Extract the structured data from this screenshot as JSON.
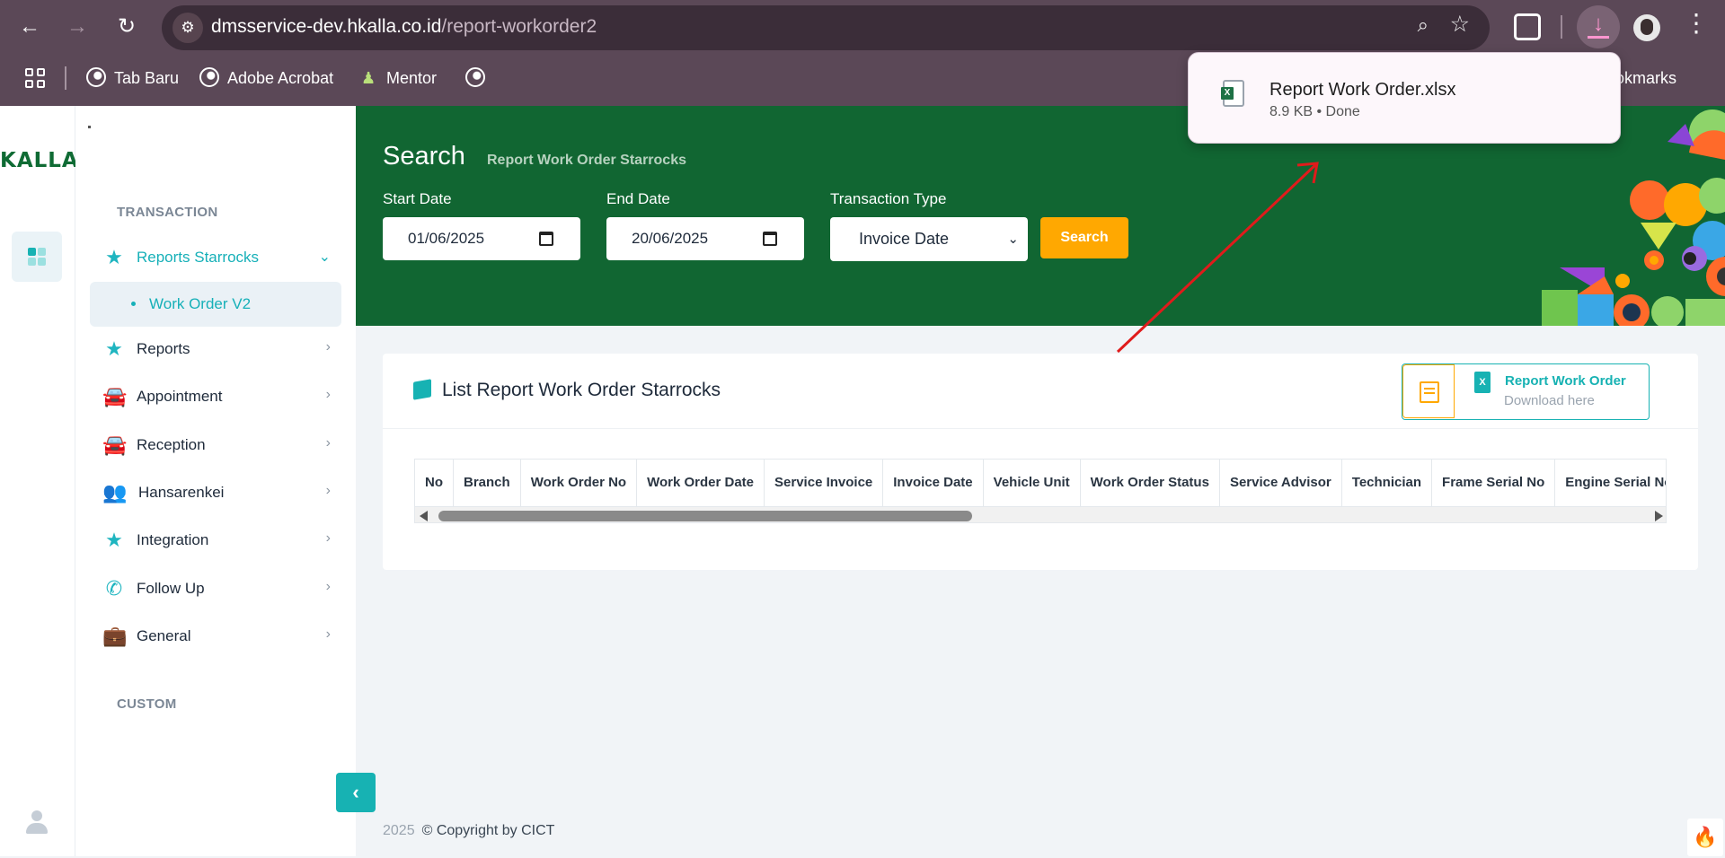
{
  "browser": {
    "url_host": "dmsservice-dev.hkalla.co.id",
    "url_path": "/report-workorder2",
    "bookmarks": [
      {
        "label": "Tab Baru",
        "icon": "globe-icon"
      },
      {
        "label": "Adobe Acrobat",
        "icon": "globe-icon"
      },
      {
        "label": "Mentor",
        "icon": "mentor-icon"
      }
    ],
    "bookmarks_right_label": "Bookmarks"
  },
  "download_popup": {
    "filename": "Report Work Order.xlsx",
    "status": "8.9 KB • Done"
  },
  "sidebar": {
    "logo": "KALLA",
    "sections": {
      "transaction": "TRANSACTION",
      "custom": "CUSTOM"
    },
    "items": [
      {
        "label": "Reports Starrocks",
        "icon": "star-icon",
        "active": true,
        "chevron": "⌄"
      },
      {
        "label": "Reports",
        "icon": "star-icon",
        "active": false,
        "chevron": "›"
      },
      {
        "label": "Appointment",
        "icon": "car-icon",
        "active": false,
        "chevron": "›"
      },
      {
        "label": "Reception",
        "icon": "car-icon",
        "active": false,
        "chevron": "›"
      },
      {
        "label": "Hansarenkei",
        "icon": "users-icon",
        "active": false,
        "chevron": "›"
      },
      {
        "label": "Integration",
        "icon": "star-icon",
        "active": false,
        "chevron": "›"
      },
      {
        "label": "Follow Up",
        "icon": "phone-icon",
        "active": false,
        "chevron": "›"
      },
      {
        "label": "General",
        "icon": "briefcase-icon",
        "active": false,
        "chevron": "›"
      }
    ],
    "subitem": "Work Order V2"
  },
  "hero": {
    "title": "Search",
    "subtitle": "Report Work Order Starrocks",
    "start_date_label": "Start Date",
    "start_date_value": "01/06/2025",
    "end_date_label": "End Date",
    "end_date_value": "20/06/2025",
    "transaction_type_label": "Transaction Type",
    "transaction_type_value": "Invoice Date",
    "search_button": "Search"
  },
  "list_card": {
    "title": "List Report Work Order Starrocks",
    "download_title": "Report Work Order",
    "download_sub": "Download here",
    "columns": [
      "No",
      "Branch",
      "Work Order No",
      "Work Order Date",
      "Service Invoice",
      "Invoice Date",
      "Vehicle Unit",
      "Work Order Status",
      "Service Advisor",
      "Technician",
      "Frame Serial No",
      "Engine Serial No"
    ]
  },
  "footer": {
    "year": "2025",
    "copyright": "© Copyright by CICT"
  },
  "colors": {
    "chrome_bg": "#5b4857",
    "hero_green": "#116632",
    "accent_teal": "#17b2b3",
    "accent_orange": "#ffa801",
    "annotation_red": "#e01b1b"
  }
}
